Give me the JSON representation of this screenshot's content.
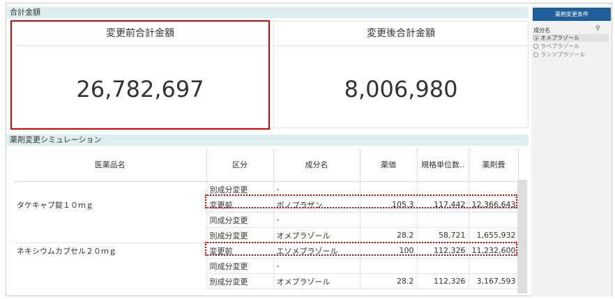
{
  "total": {
    "header": "合計金額",
    "before_title": "変更前合計金額",
    "before_value": "26,782,697",
    "after_title": "変更後合計金額",
    "after_value": "8,006,980"
  },
  "simulation": {
    "header": "薬剤変更シミュレーション",
    "columns": [
      "医薬品名",
      "区分",
      "成分名",
      "薬価",
      "規格単位数..",
      "薬剤費"
    ],
    "rows": [
      {
        "drug": "",
        "kubun": "別成分変更",
        "ingredient": "-",
        "price": "",
        "units": "",
        "cost": ""
      },
      {
        "drug": "タケキャブ錠１０ｍｇ",
        "kubun": "変更前",
        "ingredient": "ボノプラザン",
        "price": "105.3",
        "units": "117,442",
        "cost": "12,366,643"
      },
      {
        "drug": "",
        "kubun": "同成分変更",
        "ingredient": "-",
        "price": "",
        "units": "",
        "cost": ""
      },
      {
        "drug": "",
        "kubun": "別成分変更",
        "ingredient": "オメプラゾール",
        "price": "28.2",
        "units": "58,721",
        "cost": "1,655,932"
      },
      {
        "drug": "ネキシウムカプセル２０ｍｇ",
        "kubun": "変更前",
        "ingredient": "エソメプラゾール",
        "price": "100",
        "units": "112,326",
        "cost": "11,232,600"
      },
      {
        "drug": "",
        "kubun": "同成分変更",
        "ingredient": "-",
        "price": "",
        "units": "",
        "cost": ""
      },
      {
        "drug": "",
        "kubun": "別成分変更",
        "ingredient": "オメプラゾール",
        "price": "28.2",
        "units": "112,326",
        "cost": "3,167,593"
      }
    ]
  },
  "filter": {
    "button": "薬剤変更条件",
    "label": "成分名",
    "options": [
      {
        "label": "オメプラゾール",
        "selected": true
      },
      {
        "label": "ラベプラゾール",
        "selected": false
      },
      {
        "label": "ランソプラゾール",
        "selected": false
      }
    ]
  },
  "colors": {
    "accent": "#1f5f9a",
    "highlight": "#e00000",
    "section": "#ddeef0"
  },
  "icons": {
    "search": "search-icon"
  }
}
